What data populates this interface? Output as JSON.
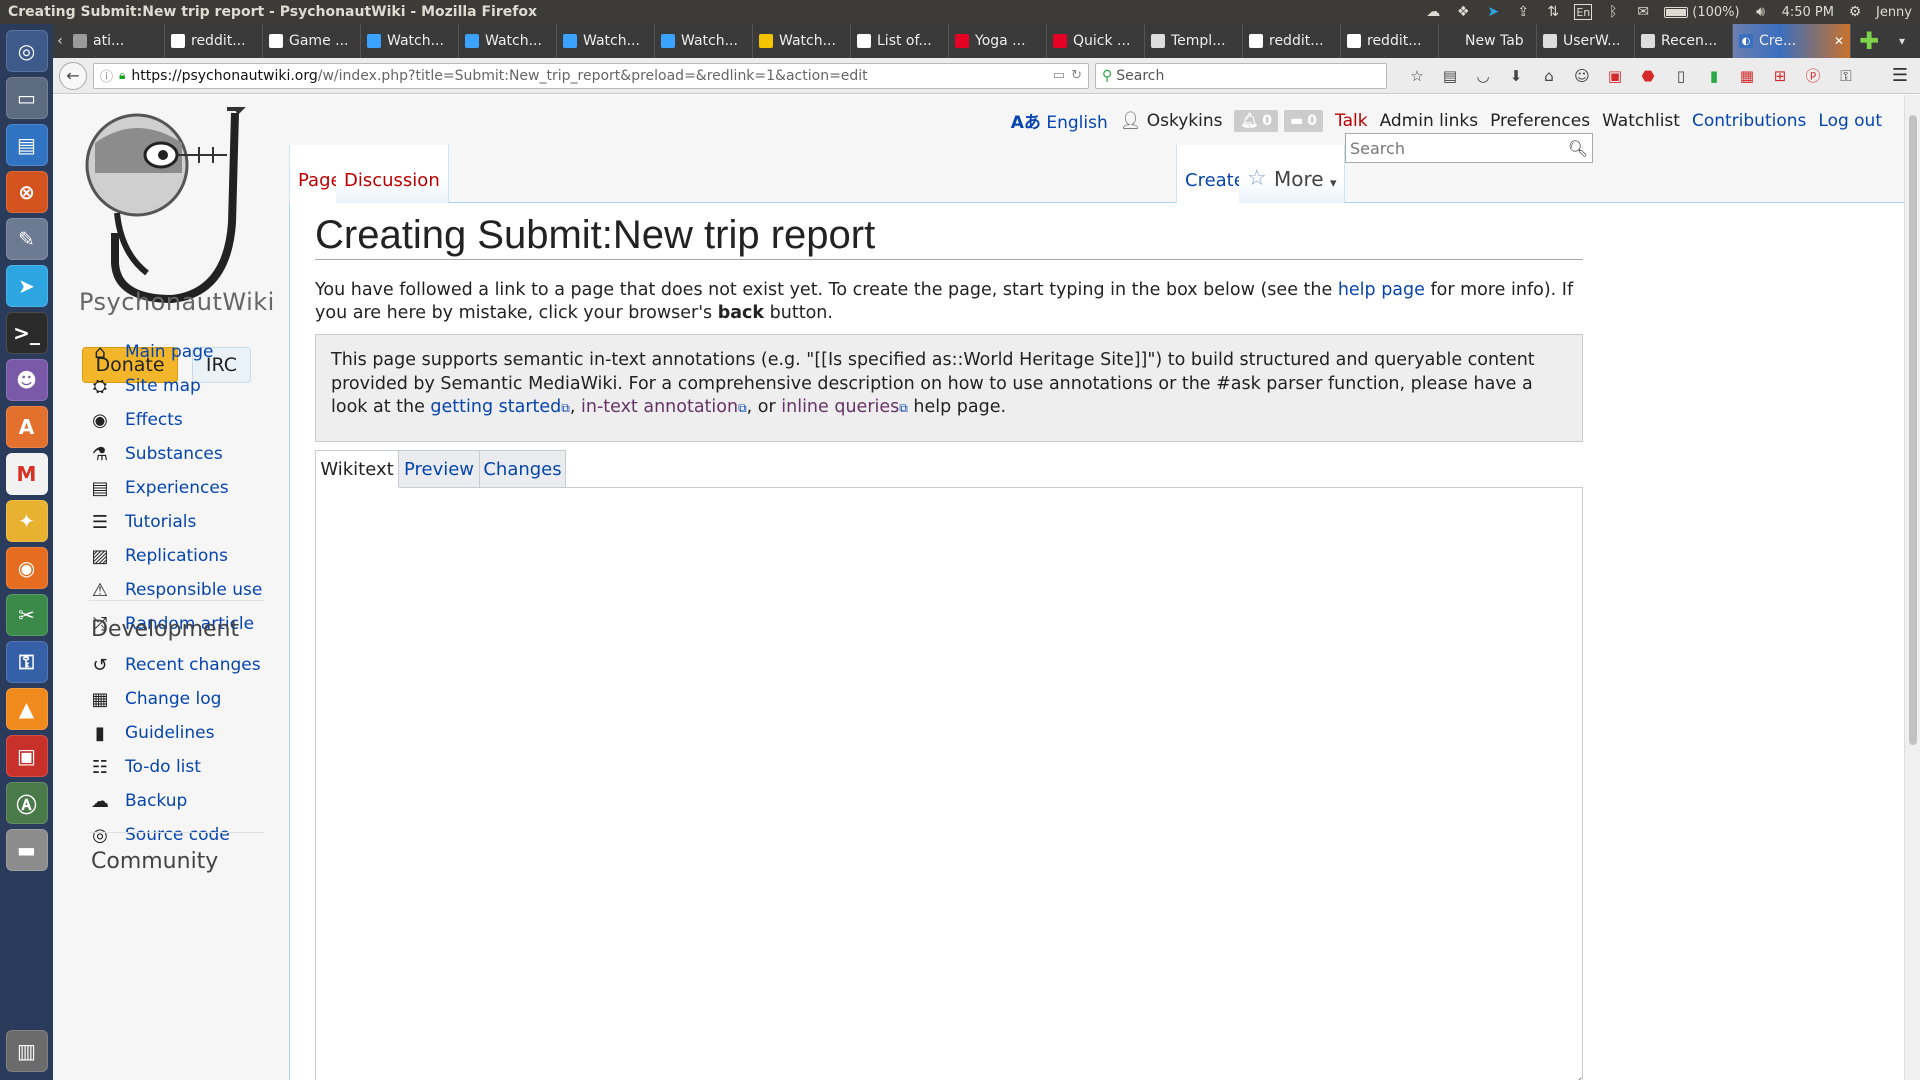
{
  "system": {
    "window_title": "Creating Submit:New trip report - PsychonautWiki - Mozilla Firefox",
    "battery": "(100%)",
    "time": "4:50 PM",
    "user": "Jenny",
    "lang_indicator": "En"
  },
  "browser": {
    "tabs": [
      {
        "label": "ati...",
        "icon": "page-icon",
        "color": "#9a9a9a"
      },
      {
        "label": "reddit...",
        "icon": "reddit-icon",
        "color": "#ffffff"
      },
      {
        "label": "Game ...",
        "icon": "wikipedia-icon",
        "color": "#ffffff"
      },
      {
        "label": "Watch...",
        "icon": "video-icon",
        "color": "#3aa3ff"
      },
      {
        "label": "Watch...",
        "icon": "video-icon",
        "color": "#3aa3ff"
      },
      {
        "label": "Watch...",
        "icon": "video-icon",
        "color": "#3aa3ff"
      },
      {
        "label": "Watch...",
        "icon": "video-icon",
        "color": "#3aa3ff"
      },
      {
        "label": "Watch...",
        "icon": "v-icon",
        "color": "#f5c400"
      },
      {
        "label": "List of...",
        "icon": "wikipedia-icon",
        "color": "#ffffff"
      },
      {
        "label": "Yoga ...",
        "icon": "pinterest-icon",
        "color": "#e60023"
      },
      {
        "label": "Quick ...",
        "icon": "pinterest-icon",
        "color": "#e60023"
      },
      {
        "label": "Templ...",
        "icon": "pin-icon",
        "color": "#dddddd"
      },
      {
        "label": "reddit...",
        "icon": "reddit-icon",
        "color": "#ffffff"
      },
      {
        "label": "reddit...",
        "icon": "reddit-icon",
        "color": "#ffffff"
      },
      {
        "label": "New Tab",
        "icon": "",
        "color": "#3a3a3a"
      },
      {
        "label": "UserW...",
        "icon": "pin-icon",
        "color": "#dddddd"
      },
      {
        "label": "Recen...",
        "icon": "pin-icon",
        "color": "#dddddd"
      }
    ],
    "active_tab": {
      "label": "Cre...",
      "close": "✕"
    },
    "url_host": "https://psychonautwiki.org",
    "url_path": "/w/index.php?title=Submit:New_trip_report&preload=&redlink=1&action=edit",
    "search_placeholder": "Search"
  },
  "wiki": {
    "logo_text": "PsychonautWiki",
    "donate_label": "Donate",
    "irc_label": "IRC",
    "nav_main": [
      {
        "label": "Main page",
        "icon": "⌂",
        "iconName": "home-icon"
      },
      {
        "label": "Site map",
        "icon": "⛭",
        "iconName": "sitemap-icon"
      },
      {
        "label": "Effects",
        "icon": "◉",
        "iconName": "eye-icon"
      },
      {
        "label": "Substances",
        "icon": "⚗",
        "iconName": "flask-icon"
      },
      {
        "label": "Experiences",
        "icon": "▤",
        "iconName": "newspaper-icon"
      },
      {
        "label": "Tutorials",
        "icon": "☰",
        "iconName": "list-icon"
      },
      {
        "label": "Replications",
        "icon": "▨",
        "iconName": "image-icon"
      },
      {
        "label": "Responsible use",
        "icon": "⚠",
        "iconName": "warning-icon"
      },
      {
        "label": "Random article",
        "icon": "⤮",
        "iconName": "shuffle-icon"
      }
    ],
    "dev_heading": "Development",
    "nav_dev": [
      {
        "label": "Recent changes",
        "icon": "↺",
        "iconName": "history-icon"
      },
      {
        "label": "Change log",
        "icon": "▦",
        "iconName": "calendar-icon"
      },
      {
        "label": "Guidelines",
        "icon": "▮",
        "iconName": "book-icon"
      },
      {
        "label": "To-do list",
        "icon": "☷",
        "iconName": "tasks-icon"
      },
      {
        "label": "Backup",
        "icon": "☁",
        "iconName": "cloud-download-icon"
      },
      {
        "label": "Source code",
        "icon": "◎",
        "iconName": "github-icon"
      }
    ],
    "community_heading": "Community",
    "personal": {
      "language": "English",
      "username": "Oskykins",
      "alerts": "0",
      "notices": "0",
      "talk": "Talk",
      "admin": "Admin links",
      "preferences": "Preferences",
      "watchlist": "Watchlist",
      "contributions": "Contributions",
      "logout": "Log out"
    },
    "tabs": {
      "page": "Page",
      "discussion": "Discussion",
      "create": "Create",
      "more": "More"
    },
    "search_placeholder": "Search",
    "page_title": "Creating Submit:New trip report",
    "intro_1": "You have followed a link to a page that does not exist yet. To create the page, start typing in the box below (see the ",
    "intro_link": "help page",
    "intro_2": " for more info). If you are here by mistake, click your browser's ",
    "intro_bold": "back",
    "intro_3": " button.",
    "smw_1": "This page supports semantic in-text annotations (e.g. \"[[Is specified as::World Heritage Site]]\") to build structured and queryable content provided by Semantic MediaWiki. For a comprehensive description on how to use annotations or the #ask parser function, please have a look at the ",
    "smw_link1": "getting started",
    "smw_sep1": ", ",
    "smw_link2": "in-text annotation",
    "smw_sep2": ", or ",
    "smw_link3": "inline queries",
    "smw_end": " help page.",
    "editor_tabs": {
      "wikitext": "Wikitext",
      "preview": "Preview",
      "changes": "Changes"
    }
  }
}
